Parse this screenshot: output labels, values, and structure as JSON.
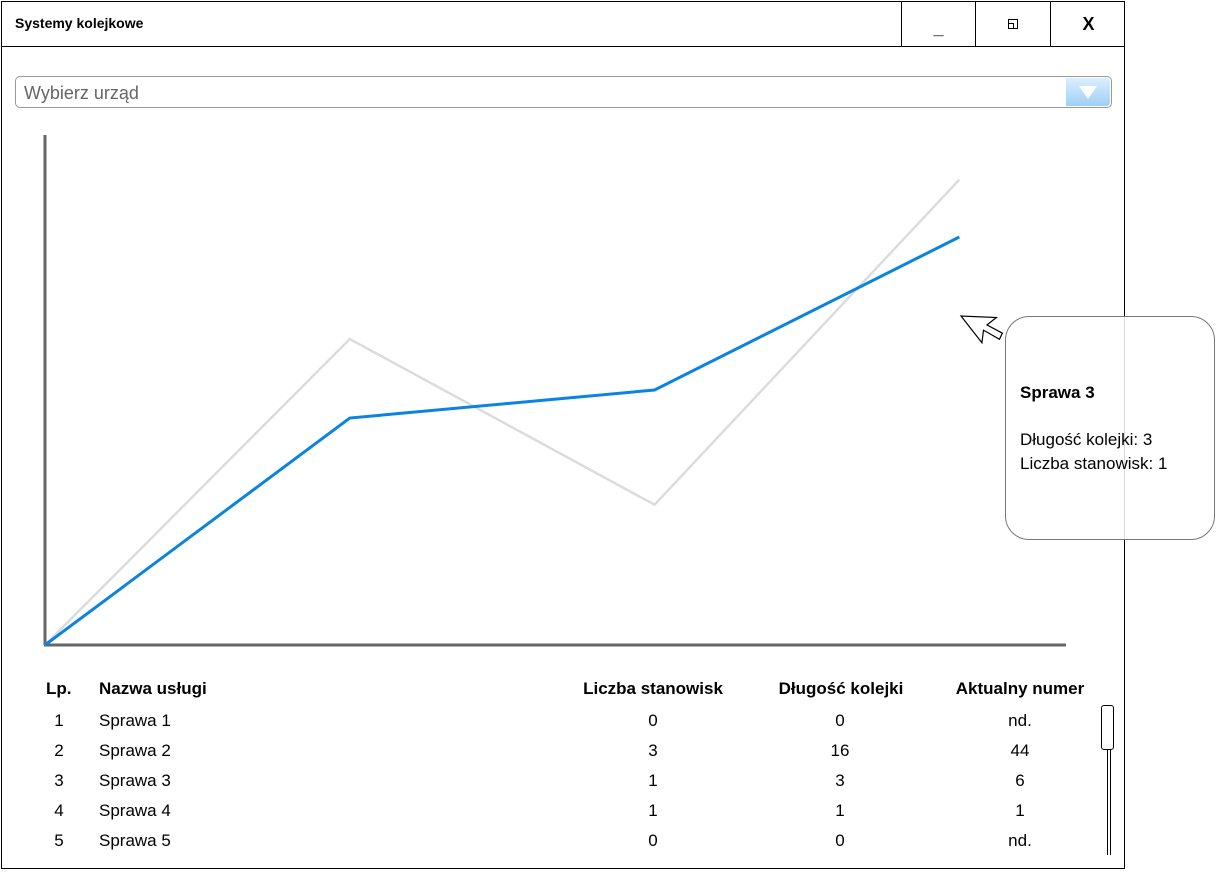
{
  "window": {
    "title": "Systemy kolejkowe",
    "minimize_label": "_",
    "close_label": "X"
  },
  "office_select": {
    "placeholder": "Wybierz urząd"
  },
  "chart_data": {
    "type": "line",
    "title": "",
    "xlabel": "",
    "ylabel": "",
    "grid": false,
    "x": [
      0,
      1,
      2,
      3
    ],
    "series": [
      {
        "color": "#0a84e0",
        "values": [
          0,
          1.78,
          2.0,
          3.2
        ]
      },
      {
        "color": "#dcdcdc",
        "values": [
          0,
          2.4,
          1.1,
          3.65
        ]
      }
    ],
    "ylim": [
      0,
      4
    ],
    "xlim": [
      0,
      3.35
    ]
  },
  "tooltip": {
    "title": "Sprawa 3",
    "line1": "Długość kolejki: 3",
    "line2": "Liczba stanowisk: 1"
  },
  "table": {
    "headers": [
      "Lp.",
      "Nazwa usługi",
      "Liczba stanowisk",
      "Długość kolejki",
      "Aktualny numer"
    ],
    "rows": [
      [
        "1",
        "Sprawa 1",
        "0",
        "0",
        "nd."
      ],
      [
        "2",
        "Sprawa 2",
        "3",
        "16",
        "44"
      ],
      [
        "3",
        "Sprawa 3",
        "1",
        "3",
        "6"
      ],
      [
        "4",
        "Sprawa 4",
        "1",
        "1",
        "1"
      ],
      [
        "5",
        "Sprawa 5",
        "0",
        "0",
        "nd."
      ]
    ]
  },
  "scrollbar": {
    "position": 0.0
  }
}
